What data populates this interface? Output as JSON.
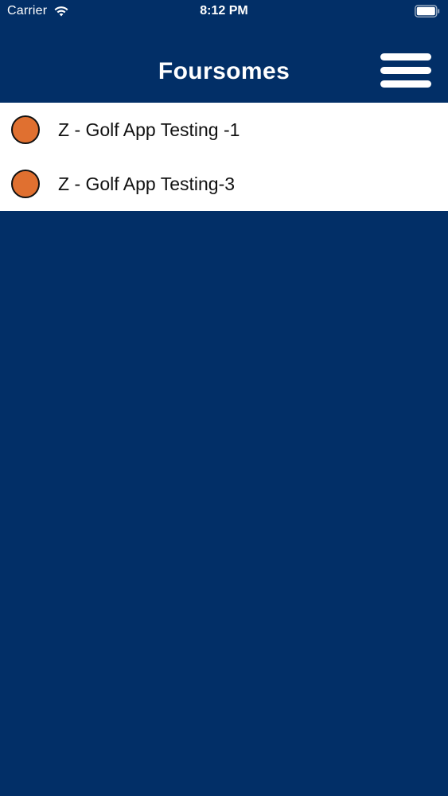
{
  "status_bar": {
    "carrier": "Carrier",
    "time": "8:12 PM",
    "wifi_icon": "wifi-icon",
    "battery_icon": "battery-icon"
  },
  "header": {
    "title": "Foursomes",
    "menu_icon": "hamburger-menu-icon"
  },
  "list": {
    "items": [
      {
        "label": "Z - Golf App Testing -1",
        "status_color": "#e07030"
      },
      {
        "label": "Z - Golf App Testing-3",
        "status_color": "#e07030"
      }
    ]
  },
  "colors": {
    "background": "#022f67",
    "list_background": "#ffffff",
    "status_dot": "#e07030",
    "header_text": "#ffffff"
  }
}
